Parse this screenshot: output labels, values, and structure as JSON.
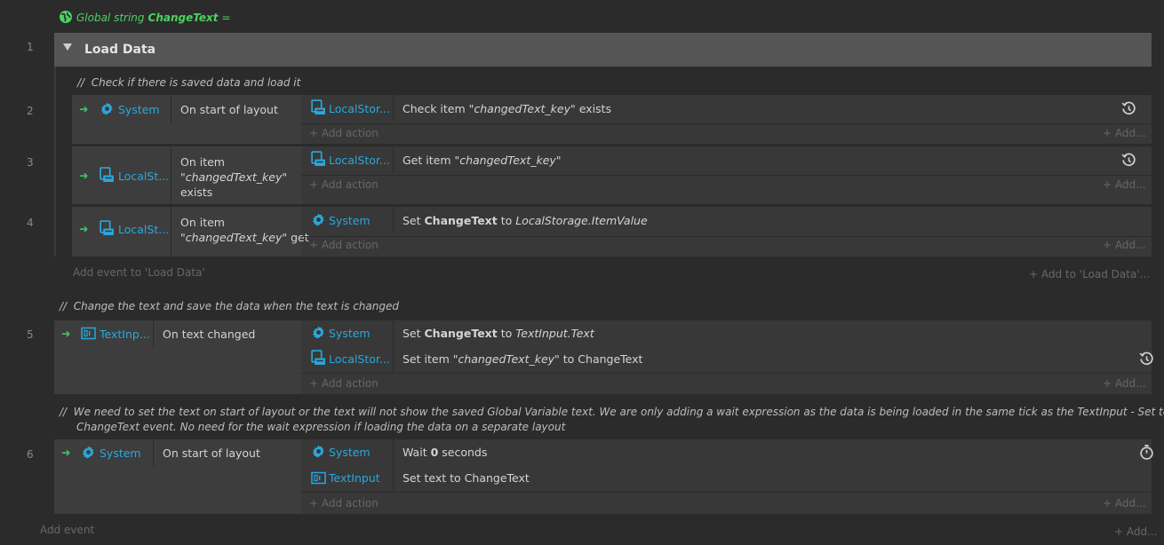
{
  "global_var": {
    "keyword": "Global string",
    "name": "ChangeText",
    "suffix": "="
  },
  "group": {
    "number": "1",
    "title": "Load Data",
    "comment": "Check if there is saved data and load it",
    "add_event": "Add event to 'Load Data'",
    "add_to": "Add to 'Load Data'..."
  },
  "events": {
    "e2": {
      "number": "2",
      "object": "System",
      "condition": "On start of layout",
      "actions": [
        {
          "object": "LocalStor...",
          "pre": "Check item ",
          "key": "\"changedText_key\"",
          "post": " exists"
        }
      ]
    },
    "e3": {
      "number": "3",
      "object": "LocalSt...",
      "cond_line1": "On item",
      "cond_key": "\"changedText_key\"",
      "cond_line3": "exists",
      "actions": [
        {
          "object": "LocalStor...",
          "pre": "Get item ",
          "key": "\"changedText_key\""
        }
      ]
    },
    "e4": {
      "number": "4",
      "object": "LocalSt...",
      "cond_line1": "On item",
      "cond_key": "\"changedText_key\"",
      "cond_post": " get",
      "actions": [
        {
          "object": "System",
          "pre": "Set ",
          "bold": "ChangeText",
          "mid": " to ",
          "italic": "LocalStorage.ItemValue"
        }
      ]
    },
    "e5": {
      "number": "5",
      "comment": "Change the text and save the data when the text is changed",
      "object": "TextInp...",
      "condition": "On text changed",
      "actions": [
        {
          "object": "System",
          "pre": "Set ",
          "bold": "ChangeText",
          "mid": " to ",
          "italic": "TextInput.Text"
        },
        {
          "object": "LocalStor...",
          "pre": "Set item ",
          "key": "\"changedText_key\"",
          "post": " to ChangeText"
        }
      ]
    },
    "e6": {
      "number": "6",
      "comment_line1": "We need to set the text on start of layout or the text will not show the saved Global Variable text. We are only adding a wait expression as the data is being loaded in the same tick as the TextInput - Set text to",
      "comment_line2": "ChangeText event. No need for the wait expression if loading the data on a separate layout",
      "object": "System",
      "condition": "On start of layout",
      "actions": [
        {
          "object": "System",
          "pre": "Wait ",
          "bold": "0",
          "post": " seconds"
        },
        {
          "object": "TextInput",
          "pre": "Set text to ChangeText"
        }
      ]
    }
  },
  "labels": {
    "add_action": "Add action",
    "add_short": "Add...",
    "add_event": "Add event",
    "comment_marker": "//"
  },
  "colors": {
    "background": "#2b2b2b",
    "group_header": "#555555",
    "object_text": "#29a8dd",
    "global_text": "#4cd160",
    "trigger_arrow": "#3cc46a"
  }
}
